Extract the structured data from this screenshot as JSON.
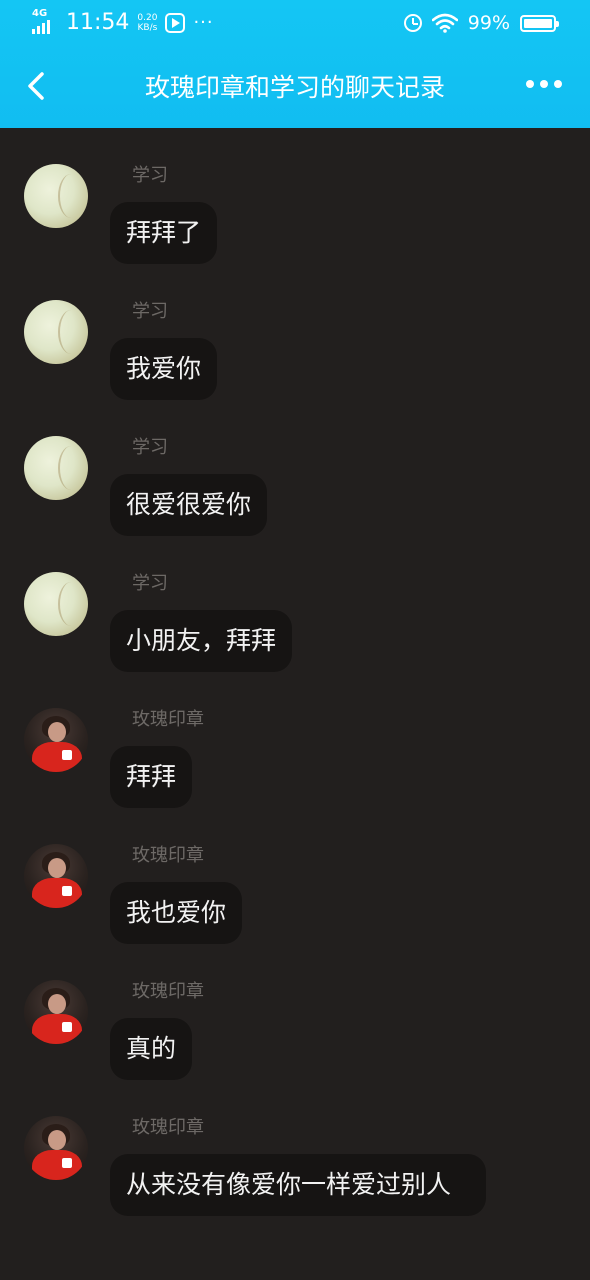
{
  "status_bar": {
    "network": "4G",
    "time": "11:54",
    "speed_value": "0.20",
    "speed_unit": "KB/s",
    "more": "···",
    "battery_percent": "99%",
    "battery_level": 0.99
  },
  "header": {
    "title": "玫瑰印章和学习的聊天记录",
    "back_icon": "chevron-left-icon",
    "more_icon": "more-horizontal-icon"
  },
  "messages": [
    {
      "sender": "学习",
      "text": "拜拜了"
    },
    {
      "sender": "学习",
      "text": "我爱你"
    },
    {
      "sender": "学习",
      "text": "很爱很爱你"
    },
    {
      "sender": "学习",
      "text": "小朋友，拜拜"
    },
    {
      "sender": "玫瑰印章",
      "text": "拜拜"
    },
    {
      "sender": "玫瑰印章",
      "text": "我也爱你"
    },
    {
      "sender": "玫瑰印章",
      "text": "真的"
    },
    {
      "sender": "玫瑰印章",
      "text": "从来没有像爱你一样爱过别人"
    }
  ],
  "colors": {
    "header": "#12c0f2",
    "background": "#221f1e",
    "bubble": "#161413",
    "sender_text": "#6d6966"
  }
}
